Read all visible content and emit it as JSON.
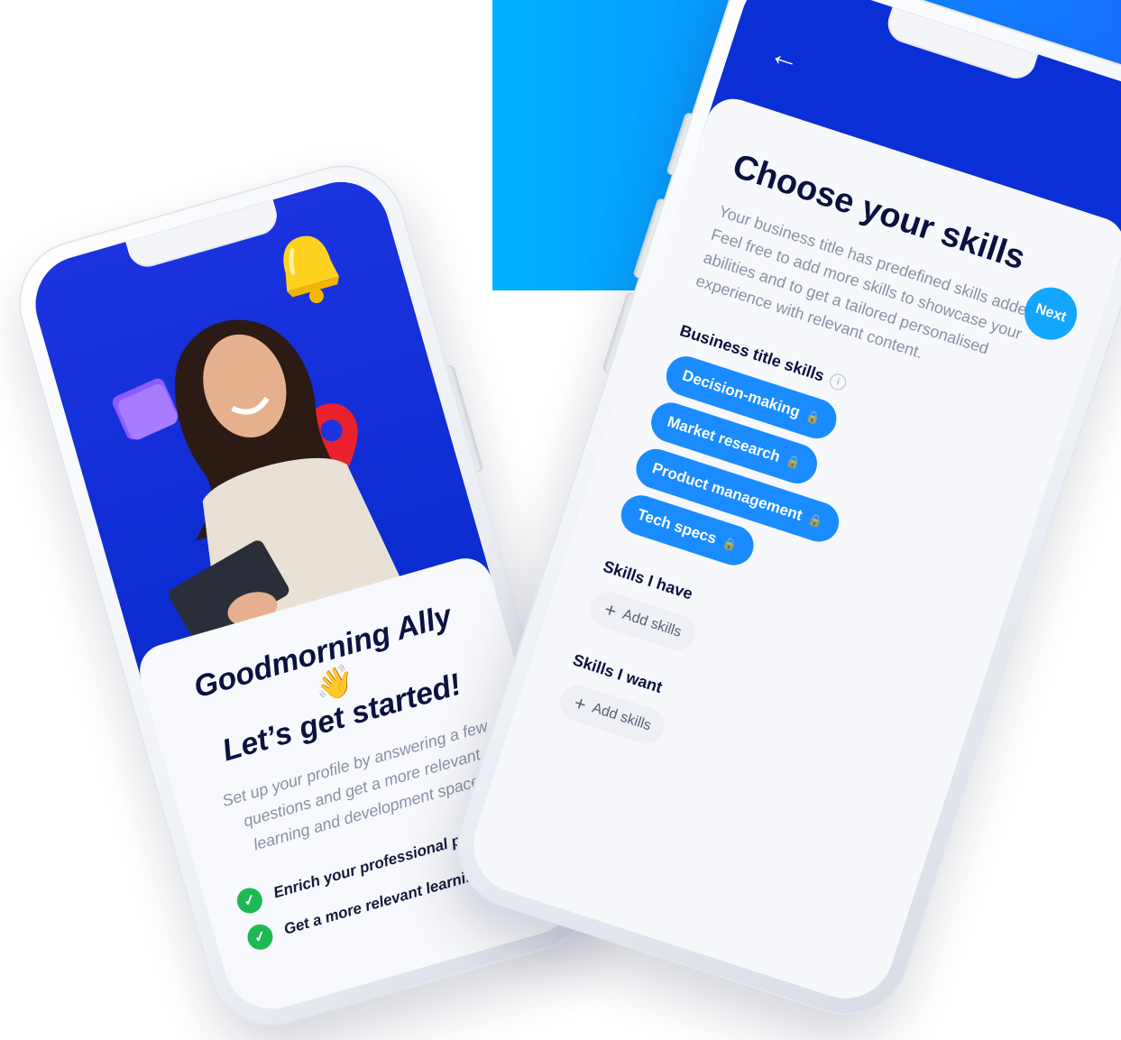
{
  "onboarding": {
    "greeting_line1": "Goodmorning Ally",
    "greeting_line2": "Let’s get started!",
    "wave_emoji": "👋",
    "description": "Set up your profile by answering a few questions and get a more relevant learning and development space.",
    "benefits": [
      {
        "label": "Enrich your professional profile",
        "icon": "check-icon"
      },
      {
        "label": "Get a more relevant learning space",
        "icon": "check-icon"
      }
    ],
    "colors": {
      "hero": "#0a2bcf",
      "check": "#1db954"
    }
  },
  "skills": {
    "back_icon": "←",
    "title": "Choose your skills",
    "next_label": "Next",
    "description": "Your business title has predefined skills added. Feel free to add more skills to showcase your abilities and to get a tailored personalised experience with relevant content.",
    "business_title_label": "Business title skills",
    "business_skills": [
      {
        "label": "Decision-making"
      },
      {
        "label": "Market research"
      },
      {
        "label": "Product management"
      },
      {
        "label": "Tech specs"
      }
    ],
    "skills_have_label": "Skills I have",
    "skills_want_label": "Skills I want",
    "add_skills_label": "Add skills",
    "colors": {
      "header": "#0b2fd6",
      "chip": "#1a8cff",
      "next": "#14a6ff"
    }
  },
  "background": {
    "gradient_start": "#00b2ff",
    "gradient_end": "#1670ff"
  }
}
